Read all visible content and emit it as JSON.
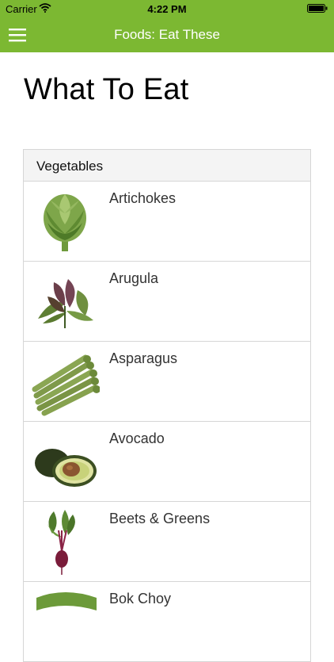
{
  "status_bar": {
    "carrier": "Carrier",
    "time": "4:22 PM"
  },
  "nav": {
    "title": "Foods: Eat These",
    "menu_icon": "hamburger-menu-icon"
  },
  "page": {
    "title": "What To Eat"
  },
  "section": {
    "header": "Vegetables",
    "items": [
      {
        "label": "Artichokes",
        "icon": "artichoke-image"
      },
      {
        "label": "Arugula",
        "icon": "arugula-image"
      },
      {
        "label": "Asparagus",
        "icon": "asparagus-image"
      },
      {
        "label": "Avocado",
        "icon": "avocado-image"
      },
      {
        "label": "Beets & Greens",
        "icon": "beet-image"
      },
      {
        "label": "Bok Choy",
        "icon": "bok-choy-image"
      }
    ]
  },
  "colors": {
    "accent": "#7cb832",
    "header_bg": "#f4f4f4",
    "border": "#d6d6d6"
  }
}
